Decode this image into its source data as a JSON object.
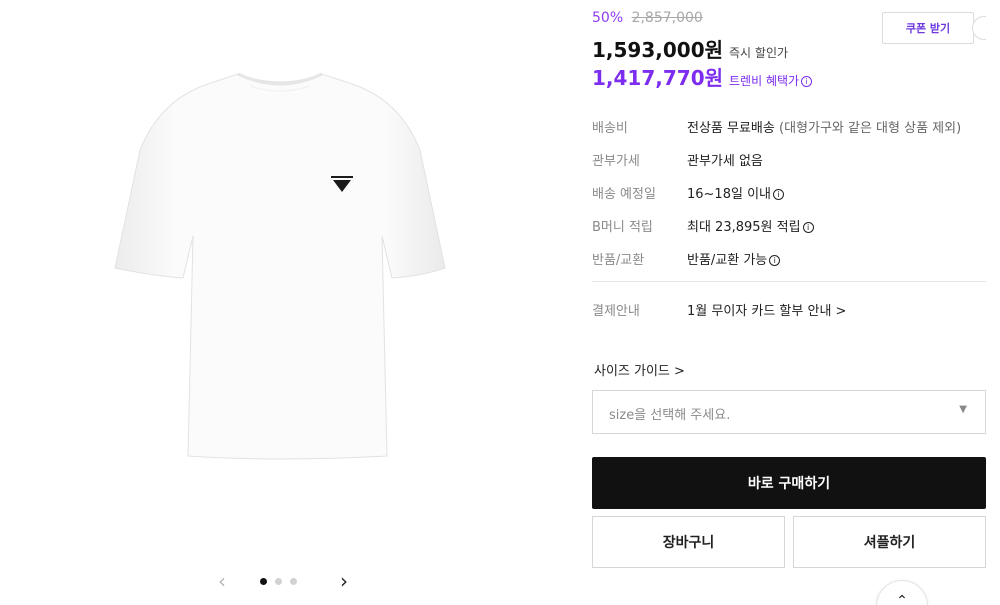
{
  "gallery": {
    "product_image_alt": "product-tshirt",
    "prev_icon": "‹",
    "next_icon": "›",
    "dots_total": 3,
    "dots_active_index": 0
  },
  "pricing": {
    "discount_pct": "50%",
    "original_price": "2,857,000",
    "coupon_label": "쿠폰 받기",
    "instant_price": "1,593,000원",
    "instant_label": "즉시 할인가",
    "benefit_price": "1,417,770원",
    "benefit_label": "트렌비 혜택가"
  },
  "specs": [
    {
      "key": "배송비",
      "value": "전상품 무료배송",
      "note": "(대형가구와 같은 대형 상품 제외)"
    },
    {
      "key": "관부가세",
      "value": "관부가세 없음",
      "note": ""
    },
    {
      "key": "배송 예정일",
      "value": "16~18일 이내",
      "note": ""
    },
    {
      "key": "B머니 적립",
      "value": "최대 23,895원 적립",
      "note": ""
    },
    {
      "key": "반품/교환",
      "value": "반품/교환 가능",
      "note": ""
    }
  ],
  "payment": {
    "key": "결제안내",
    "value": "1월 무이자 카드 할부 안내 >"
  },
  "size": {
    "guide_label": "사이즈 가이드 >",
    "select_placeholder": "size을 선택해 주세요."
  },
  "actions": {
    "buy_now": "바로 구매하기",
    "cart": "장바구니",
    "shuffle": "셔플하기"
  },
  "colors": {
    "accent_purple": "#7d2df0",
    "discount_purple": "#8e3cf0",
    "buy_button_bg": "#111111"
  }
}
